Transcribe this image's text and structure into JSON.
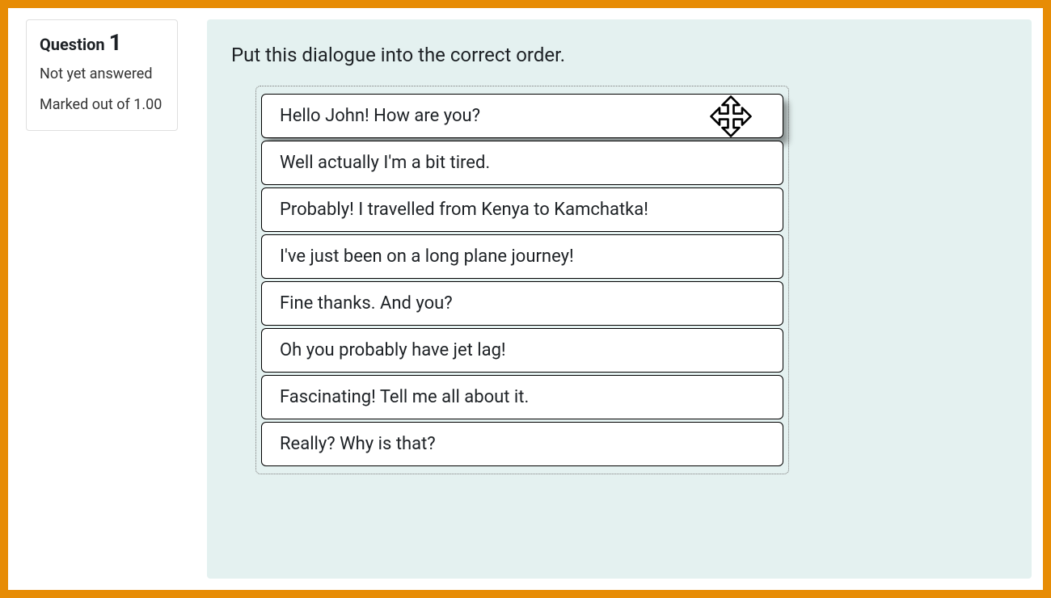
{
  "info": {
    "question_label": "Question",
    "question_number": "1",
    "status": "Not yet answered",
    "marks": "Marked out of 1.00"
  },
  "question": {
    "prompt": "Put this dialogue into the correct order.",
    "items": [
      "Hello John! How are you?",
      "Well actually I'm a bit tired.",
      "Probably! I travelled from Kenya to Kamchatka!",
      "I've just been on a long plane journey!",
      "Fine thanks. And you?",
      "Oh you probably have jet lag!",
      "Fascinating! Tell me all about it.",
      "Really? Why is that?"
    ],
    "active_index": 0
  }
}
